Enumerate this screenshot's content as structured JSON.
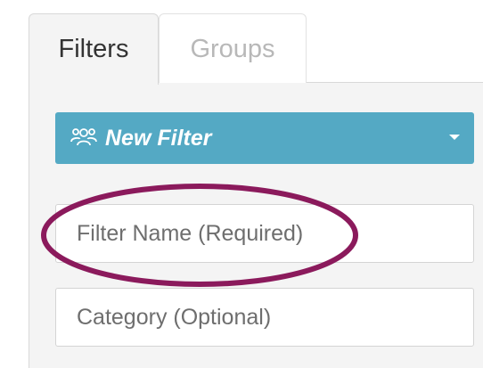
{
  "tabs": [
    {
      "label": "Filters",
      "active": true
    },
    {
      "label": "Groups",
      "active": false
    }
  ],
  "new_filter": {
    "label": "New Filter",
    "icon": "users-icon",
    "accent_color": "#54a9c4"
  },
  "fields": {
    "filter_name": {
      "value": "",
      "placeholder": "Filter Name (Required)"
    },
    "category": {
      "value": "",
      "placeholder": "Category (Optional)"
    }
  },
  "annotation": {
    "type": "ellipse-highlight",
    "target": "filter_name",
    "color": "#8b1a5c"
  }
}
